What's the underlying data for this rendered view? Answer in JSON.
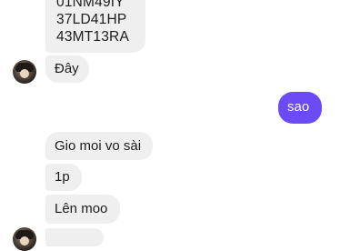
{
  "messages": {
    "incoming_top": {
      "lines": [
        "01NM49IY",
        "37LD41HP",
        "43MT13RA"
      ]
    },
    "incoming_day": "Đây",
    "outgoing_sao": "sao",
    "incoming_gio": "Gio moi vo sài",
    "incoming_1p": "1p",
    "incoming_len": "Lên moo"
  },
  "colors": {
    "incoming_bubble": "#efefef",
    "outgoing_bubble": "#6b4bf5",
    "background": "#ffffff"
  }
}
